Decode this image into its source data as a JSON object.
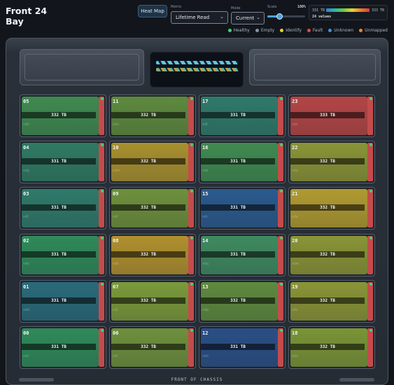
{
  "header": {
    "title_line1": "Front 24",
    "title_line2": "Bay"
  },
  "controls": {
    "heatmap_button": "Heat Map",
    "metric_label": "Metric",
    "metric_value": "Lifetime Read",
    "mode_label": "Mode",
    "mode_value": "Current",
    "scale_label": "Scale",
    "scale_value": "100%",
    "scale_fraction": 1.0
  },
  "heat_legend": {
    "min": "331 TB",
    "max": "333 TB",
    "count": "24 values"
  },
  "status_legend": [
    {
      "label": "Healthy",
      "color": "#3fd46e"
    },
    {
      "label": "Empty",
      "color": "#8a93a0"
    },
    {
      "label": "Identify",
      "color": "#e2cf3a"
    },
    {
      "label": "Fault",
      "color": "#e04848"
    },
    {
      "label": "Unknown",
      "color": "#4a8de0"
    },
    {
      "label": "Unmapped",
      "color": "#e08a3a"
    }
  ],
  "bays": [
    {
      "slot": "05",
      "value": "332 TB",
      "dev": "sdh",
      "color": "#3f8a50"
    },
    {
      "slot": "11",
      "value": "332 TB",
      "dev": "sdn",
      "color": "#5e8a3e"
    },
    {
      "slot": "17",
      "value": "331 TB",
      "dev": "sdt",
      "color": "#2f7a6a"
    },
    {
      "slot": "23",
      "value": "333 TB",
      "dev": "sdz",
      "color": "#b44545"
    },
    {
      "slot": "04",
      "value": "331 TB",
      "dev": "sdg",
      "color": "#2f7a62"
    },
    {
      "slot": "10",
      "value": "332 TB",
      "dev": "sdm",
      "color": "#a8902e"
    },
    {
      "slot": "16",
      "value": "331 TB",
      "dev": "sds",
      "color": "#3f8a50"
    },
    {
      "slot": "22",
      "value": "332 TB",
      "dev": "sdy",
      "color": "#8a9436"
    },
    {
      "slot": "03",
      "value": "331 TB",
      "dev": "sdf",
      "color": "#2f7a6a"
    },
    {
      "slot": "09",
      "value": "332 TB",
      "dev": "sdl",
      "color": "#6e903c"
    },
    {
      "slot": "15",
      "value": "331 TB",
      "dev": "sdr",
      "color": "#2a5a8e"
    },
    {
      "slot": "21",
      "value": "332 TB",
      "dev": "sdx",
      "color": "#b09a30"
    },
    {
      "slot": "02",
      "value": "331 TB",
      "dev": "sde",
      "color": "#2f8a5a"
    },
    {
      "slot": "08",
      "value": "332 TB",
      "dev": "sdk",
      "color": "#b0902e"
    },
    {
      "slot": "14",
      "value": "331 TB",
      "dev": "sdq",
      "color": "#3f8a60"
    },
    {
      "slot": "20",
      "value": "332 TB",
      "dev": "sdw",
      "color": "#8a9436"
    },
    {
      "slot": "01",
      "value": "331 TB",
      "dev": "sdd",
      "color": "#2a6a7a"
    },
    {
      "slot": "07",
      "value": "332 TB",
      "dev": "sdj",
      "color": "#7a9a3a"
    },
    {
      "slot": "13",
      "value": "332 TB",
      "dev": "sdp",
      "color": "#5e8a3e"
    },
    {
      "slot": "19",
      "value": "332 TB",
      "dev": "sdv",
      "color": "#8a9436"
    },
    {
      "slot": "00",
      "value": "331 TB",
      "dev": "sdc",
      "color": "#2f8a5a"
    },
    {
      "slot": "06",
      "value": "332 TB",
      "dev": "sdi",
      "color": "#6e903c"
    },
    {
      "slot": "12",
      "value": "331 TB",
      "dev": "sdo",
      "color": "#2a4f86"
    },
    {
      "slot": "18",
      "value": "332 TB",
      "dev": "sdu",
      "color": "#7a9436"
    }
  ],
  "footer": {
    "label": "FRONT OF CHASSIS"
  }
}
